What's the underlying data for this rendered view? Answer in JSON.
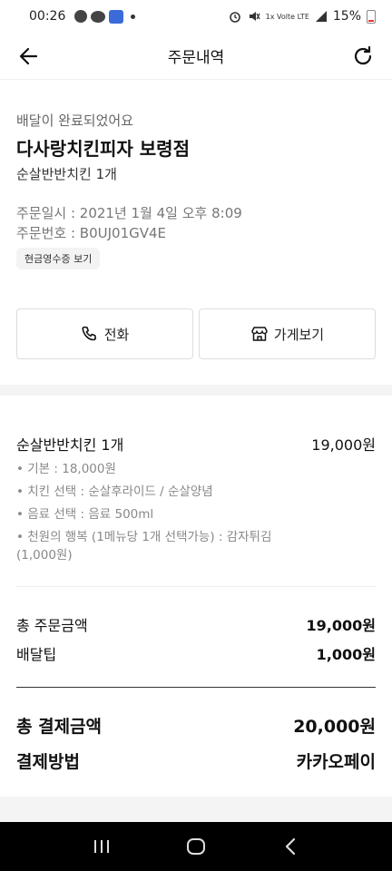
{
  "statusbar": {
    "time": "00:26",
    "network_small": "1x Volte LTE",
    "battery": "15%"
  },
  "header": {
    "title": "주문내역"
  },
  "order": {
    "status_message": "배달이 완료되었어요",
    "store_name": "다사랑치킨피자 보령점",
    "menu_summary": "순살반반치킨 1개",
    "order_date": "주문일시 : 2021년 1월 4일 오후 8:09",
    "order_number": "주문번호 : B0UJ01GV4E",
    "receipt_button": "현금영수증 보기"
  },
  "actions": {
    "call_label": "전화",
    "store_label": "가게보기"
  },
  "item": {
    "name": "순살반반치킨 1개",
    "price": "19,000원",
    "options": [
      "• 기본 : 18,000원",
      "• 치킨 선택 : 순살후라이드 / 순살양념",
      "• 음료 선택 : 음료 500ml",
      "• 천원의 행복 (1메뉴당 1개 선택가능) : 감자튀김",
      "(1,000원)"
    ]
  },
  "summary": {
    "order_total_label": "총 주문금액",
    "order_total_value": "19,000원",
    "delivery_tip_label": "배달팁",
    "delivery_tip_value": "1,000원",
    "payment_total_label": "총 결제금액",
    "payment_total_value": "20,000원",
    "payment_method_label": "결제방법",
    "payment_method_value": "카카오페이"
  },
  "colors": {
    "divider": "#f4f4f4",
    "muted_text": "#888888",
    "navbar": "#000000"
  }
}
